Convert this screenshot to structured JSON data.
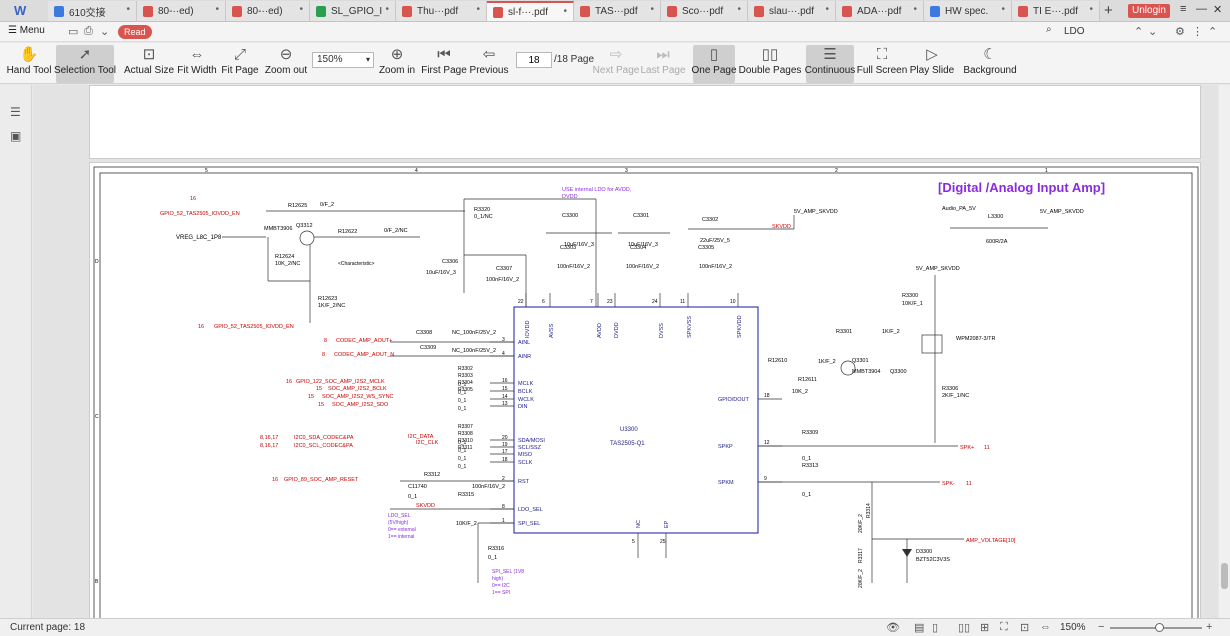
{
  "tabs": [
    {
      "label": "610交接",
      "color": "#3b7be0"
    },
    {
      "label": "80-··ed)",
      "color": "#d9534f"
    },
    {
      "label": "80-··ed)",
      "color": "#d9534f"
    },
    {
      "label": "SL_GPIO_I",
      "color": "#2a9d4e"
    },
    {
      "label": "Thu···pdf",
      "color": "#d9534f"
    },
    {
      "label": "sl-f···.pdf",
      "color": "#d9534f"
    },
    {
      "label": "TAS···pdf",
      "color": "#d9534f"
    },
    {
      "label": "Sco···pdf",
      "color": "#d9534f"
    },
    {
      "label": "slau···.pdf",
      "color": "#d9534f"
    },
    {
      "label": "ADA···pdf",
      "color": "#d9534f"
    },
    {
      "label": "HW spec.",
      "color": "#3b7be0"
    },
    {
      "label": "TI E···.pdf",
      "color": "#d9534f"
    }
  ],
  "app": {
    "logo": "W",
    "unlogin": "Unlogin",
    "newtab": "+"
  },
  "menubar": {
    "menu": "Menu",
    "read": "Read",
    "search_value": "LDO"
  },
  "toolbar": {
    "hand_tool": "Hand Tool",
    "selection_tool": "Selection Tool",
    "actual_size": "Actual Size",
    "fit_width": "Fit Width",
    "fit_page": "Fit Page",
    "zoom_out": "Zoom out",
    "zoom_value": "150%",
    "zoom_in": "Zoom in",
    "first_page": "First Page",
    "previous": "Previous",
    "page_value": "18",
    "page_total": "/18 Page",
    "next_page": "Next Page",
    "last_page": "Last Page",
    "one_page": "One Page",
    "double_pages": "Double Pages",
    "continuous": "Continuous",
    "full_screen": "Full Screen",
    "play_slide": "Play Slide",
    "background": "Background"
  },
  "status": {
    "current_page": "Current page: 18",
    "zoom": "150%"
  },
  "schematic": {
    "title": "[Digital /Analog Input Amp]",
    "grid_top": [
      "5",
      "4",
      "3",
      "2",
      "1"
    ],
    "grid_left": [
      "D",
      "C",
      "B"
    ],
    "usenote": "USE internal LDO for AVDD,",
    "usenote2": "DVDD",
    "ic_name": "U3300",
    "ic_part": "TAS2505-Q1",
    "pins_left": [
      "IOVDD",
      "AVSS",
      "AVDD",
      "DVDD",
      "DVSS",
      "SPKVSS",
      "SPKVDD"
    ],
    "pin_nums_top": [
      "22",
      "6",
      "7",
      "23",
      "24",
      "11",
      "10"
    ],
    "pins_side": [
      "AINL",
      "AINR",
      "MCLK",
      "BCLK",
      "WCLK",
      "DIN",
      "SDA/MOSI",
      "SCL/SSZ",
      "MISO",
      "SCLK",
      "RST",
      "LDO_SEL",
      "SPI_SEL"
    ],
    "pins_side_nums": [
      "3",
      "4",
      "16",
      "15",
      "14",
      "13",
      "20",
      "19",
      "17",
      "18",
      "2",
      "8",
      "1"
    ],
    "pins_right": [
      "GPIO/DOUT",
      "SPKP",
      "SPKM"
    ],
    "pins_right_nums": [
      "18",
      "12",
      "9"
    ],
    "pins_bottom": [
      "NC",
      "EP"
    ],
    "pins_bottom_nums": [
      "5",
      "25"
    ],
    "nets_red": [
      {
        "num": "16",
        "label": "GPIO_52_TAS2505_IOVDD_EN"
      },
      {
        "num": "16",
        "label": "GPIO_52_TAS2505_IOVDD_EN"
      },
      {
        "num": "8",
        "label": "CODEC_AMP_AOUT+"
      },
      {
        "num": "8",
        "label": "CODEC_AMP_AOUT_N"
      },
      {
        "num": "16",
        "label": "GPIO_122_SOC_AMP_I2S2_MCLK"
      },
      {
        "num": "15",
        "label": "SOC_AMP_I2S2_BCLK"
      },
      {
        "num": "15",
        "label": "SOC_AMP_I2S2_WS_SYNC"
      },
      {
        "num": "15",
        "label": "SOC_AMP_I2S2_SDO"
      },
      {
        "num": "8,16,17",
        "label": "I2C0_SDA_CODEC&PA"
      },
      {
        "num": "8,16,17",
        "label": "I2C0_SCL_CODEC&PA"
      },
      {
        "num": "16",
        "label": "GPIO_89_SOC_AMP_RESET"
      }
    ],
    "vreg": "VREG_L8C_1P8",
    "q3312": "MMBT3906",
    "q3312_ref": "Q3312",
    "r12625": "R12625",
    "r12625_v": "0/F_2",
    "r12622": "R12622",
    "r12622_v": "0/F_2/NC",
    "r12624": "R12624",
    "r12624_v": "10K_2/NC",
    "r12623": "R12623",
    "r12623_v": "1K/F_2/NC",
    "characteristic": "<Characteristic>",
    "r3320": "R3320",
    "r3320_v": "0_1/NC",
    "c3306": "C3306",
    "c3306_v": "10uF/16V_3",
    "c3307": "C3307",
    "c3307_v": "100nF/16V_2",
    "c3300": "C3300",
    "c3300_v": "10uF/16V_3",
    "c3303": "C3303",
    "c3303_v": "100nF/16V_2",
    "c3301": "C3301",
    "c3301_v": "10uF/16V_3",
    "c3304": "C3304",
    "c3304_v": "100nF/16V_2",
    "c3302": "C3302",
    "c3302_v": "22uF/25V_5",
    "c3305": "C3305",
    "c3305_v": "100nF/16V_2",
    "skvdd": "SKVDD",
    "v5_amp": "5V_AMP_SKVDD",
    "audio_pa": "Audio_PA_5V",
    "l3300": "L3300",
    "l3300_v": "600R/2A",
    "v5_amp2": "5V_AMP_SKVDD",
    "c3308": "C3308",
    "c3308_v": "NC_100nF/25V_2",
    "c3309": "C3309",
    "c3309_v": "NC_100nF/25V_2",
    "r3302_list": [
      "R3302",
      "R3303",
      "R3304",
      "R3305",
      "0_1",
      "0_1",
      "0_1",
      "0_1"
    ],
    "i2c_data": "I2C_DATA",
    "i2c_clk": "I2C_CLK",
    "r3307_list": [
      "R3307",
      "R3308",
      "R3310",
      "R3311",
      "0_1",
      "0_1",
      "0_1",
      "0_1"
    ],
    "r3312": "R3312",
    "c11740": "C11740",
    "c11740_v": "0_1",
    "c_100n": "100nF/16V_2",
    "r3315": "R3315",
    "skvdd2": "SKVDD",
    "ldo_sel_note": [
      "LDO_SEL",
      "(5V/high)",
      "0== external",
      "1== internal"
    ],
    "r10k": "10K/F_2",
    "r3316": "R3316",
    "r3316_v": "0_1",
    "spi_sel_note": [
      "SPI_SEL (1V8",
      "high)",
      "0== I2C",
      "1== SPI"
    ],
    "r12610": "R12610",
    "r12611": "R12611",
    "r12611_v": "10K_2",
    "r1kf": "1K/F_2",
    "q3301": "Q3301",
    "q3301_v": "MMBT3904",
    "q3300": "Q3300",
    "r3301": "R3301",
    "r3301_v": "1K/F_2",
    "r3300": "R3300",
    "r3300_v": "10K/F_1",
    "v5_amp3": "5V_AMP_SKVDD",
    "wpm": "WPM2087-3/TR",
    "r3306": "R3306",
    "r3306_v": "2K/F_1/NC",
    "r3309": "R3309",
    "r3309_v": "0_1",
    "r3313": "R3313",
    "r3313_v": "0_1",
    "spk_p": "SPK+",
    "spk_p_num": "11",
    "spk_m": "SPK-",
    "spk_m_num": "11",
    "r3314": "R3314",
    "r3314_v": "20K/F_2",
    "r3317": "R3317",
    "r3317_v": "20K/F_2",
    "d3300": "D3300",
    "d3300_v": "BZT52C3V3S",
    "amp_voltage": "AMP_VOLTAGE[10]"
  }
}
